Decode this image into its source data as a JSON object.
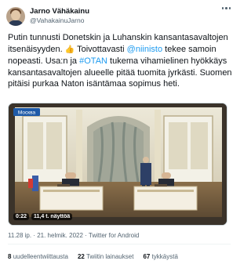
{
  "author": {
    "display_name": "Jarno Vähäkainu",
    "handle": "@VahakainuJarno"
  },
  "tweet": {
    "text_1": "Putin tunnusti Donetskin ja Luhanskin kansantasavaltojen itsenäisyyden. ",
    "emoji_thumbs": "👍",
    "text_2": " Toivottavasti ",
    "mention": "@niinisto",
    "text_3": " tekee samoin nopeasti. Usa:n ja ",
    "hashtag": "#OTAN",
    "text_4": " tukema vihamielinen hyökkäys kansantasavaltojen alueelle pitää tuomita jyrkästi. Suomen pitäisi purkaa Naton isäntämaa sopimus heti."
  },
  "media": {
    "channel_logo": "Москва",
    "duration": "0:22",
    "views": "11,4 t. näyttöä"
  },
  "meta": {
    "timestamp": "11.28 ip. · 21. helmik. 2022 · Twitter for Android"
  },
  "stats": {
    "retweets_count": "8",
    "retweets_label": "uudelleentwiittausta",
    "quotes_count": "22",
    "quotes_label": "Twiitin lainaukset",
    "likes_count": "67",
    "likes_label": "tykkäystä"
  },
  "colors": {
    "link": "#1d9bf0",
    "secondary_text": "#536471"
  }
}
